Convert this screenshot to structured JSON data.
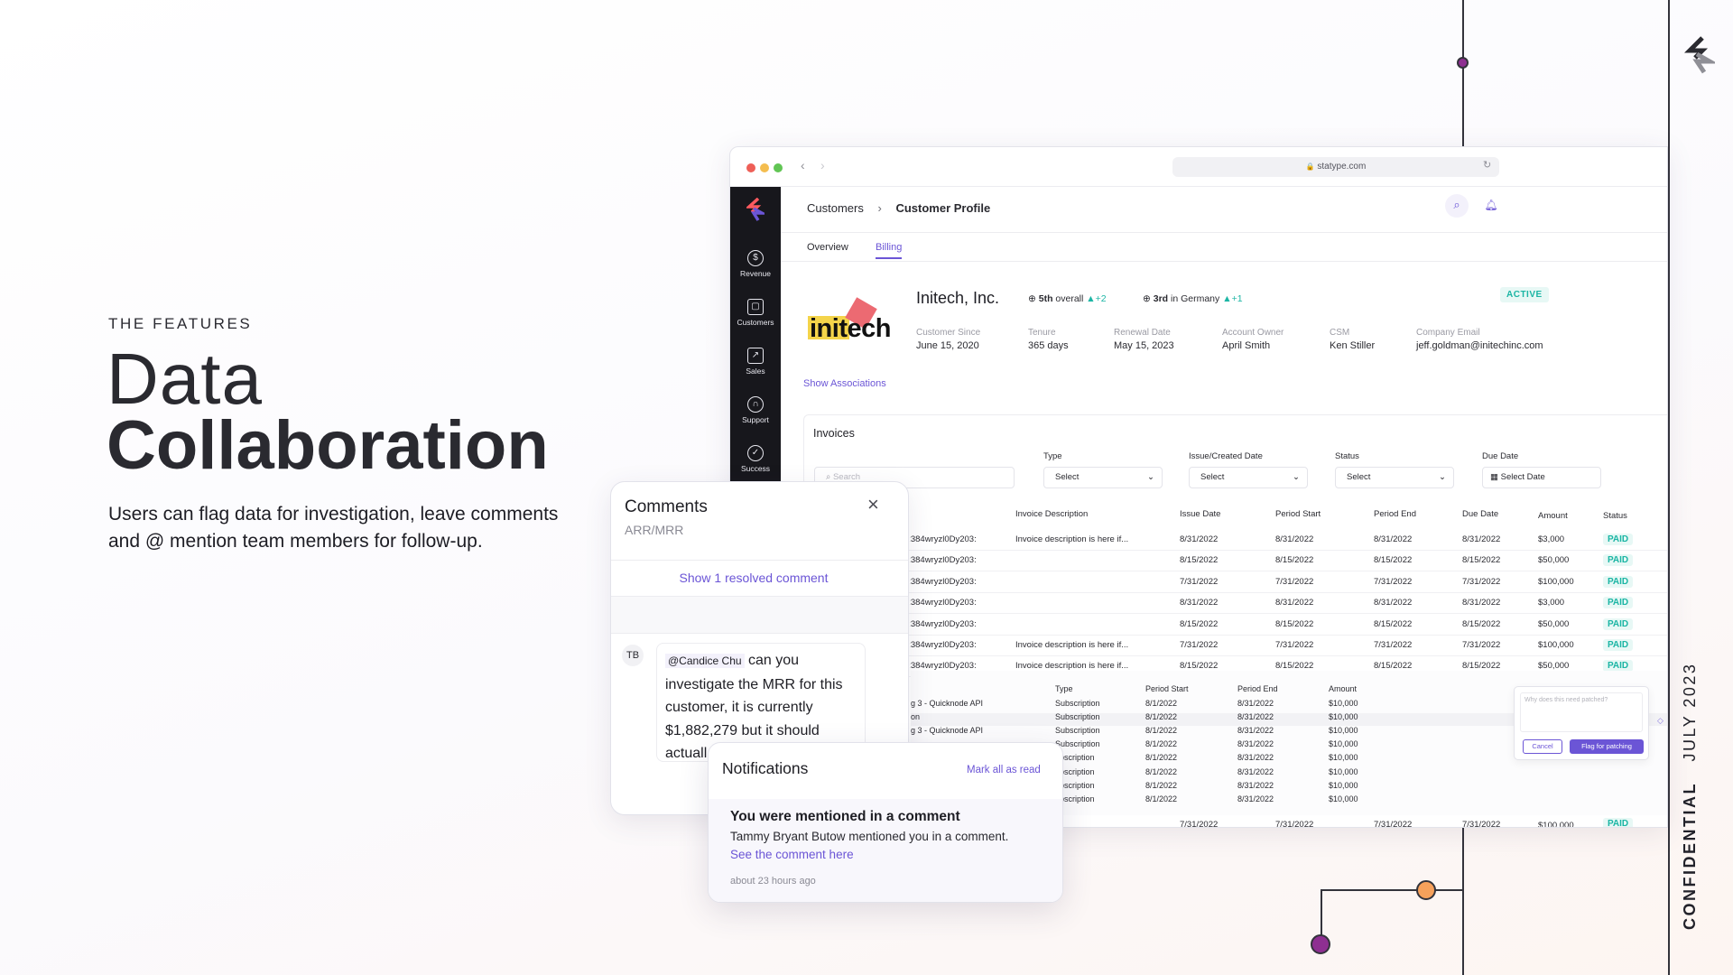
{
  "slide": {
    "eyebrow": "THE FEATURES",
    "title_light": "Data",
    "title_bold": "Collaboration",
    "body": "Users can flag data for investigation, leave comments and @ mention team members for follow-up.",
    "rail_confidential": "CONFIDENTIAL",
    "rail_date": "JULY 2023"
  },
  "browser": {
    "url": "statype.com",
    "breadcrumb": [
      "Customers",
      "Customer Profile"
    ],
    "tabs": [
      "Overview",
      "Billing"
    ],
    "active_tab": "Billing"
  },
  "sidebar": {
    "items": [
      {
        "label": "Revenue",
        "icon": "dollar-icon"
      },
      {
        "label": "Customers",
        "icon": "customers-icon"
      },
      {
        "label": "Sales",
        "icon": "chart-icon"
      },
      {
        "label": "Support",
        "icon": "headset-icon"
      },
      {
        "label": "Success",
        "icon": "check-icon"
      }
    ]
  },
  "customer": {
    "logo_text": "initech",
    "name": "Initech, Inc.",
    "rank_overall": "5th",
    "rank_overall_suffix": "overall",
    "rank_overall_delta": "+2",
    "rank_country": "3rd",
    "rank_country_suffix": "in Germany",
    "rank_country_delta": "+1",
    "status": "ACTIVE",
    "fields": [
      {
        "label": "Customer Since",
        "value": "June 15, 2020"
      },
      {
        "label": "Tenure",
        "value": "365 days"
      },
      {
        "label": "Renewal Date",
        "value": "May 15, 2023"
      },
      {
        "label": "Account Owner",
        "value": "April Smith"
      },
      {
        "label": "CSM",
        "value": "Ken Stiller"
      },
      {
        "label": "Company Email",
        "value": "jeff.goldman@initechinc.com"
      }
    ],
    "show_associations": "Show Associations"
  },
  "invoices": {
    "title": "Invoices",
    "search_placeholder": "Search",
    "filters": [
      {
        "label": "Type",
        "value": "Select"
      },
      {
        "label": "Issue/Created Date",
        "value": "Select"
      },
      {
        "label": "Status",
        "value": "Select"
      },
      {
        "label": "Due Date",
        "value": "Select Date"
      }
    ],
    "columns": [
      "Invoice Description",
      "Issue Date",
      "Period Start",
      "Period End",
      "Due Date",
      "Amount",
      "Status"
    ],
    "rows": [
      {
        "id": ":R384wryzl0Dy203",
        "desc": "Invoice description is here if...",
        "issue": "8/31/2022",
        "start": "8/31/2022",
        "end": "8/31/2022",
        "due": "8/31/2022",
        "amount": "$3,000",
        "status": "PAID"
      },
      {
        "id": ":R384wryzl0Dy203",
        "desc": "",
        "issue": "8/15/2022",
        "start": "8/15/2022",
        "end": "8/15/2022",
        "due": "8/15/2022",
        "amount": "$50,000",
        "status": "PAID"
      },
      {
        "id": ":R384wryzl0Dy203",
        "desc": "",
        "issue": "7/31/2022",
        "start": "7/31/2022",
        "end": "7/31/2022",
        "due": "7/31/2022",
        "amount": "$100,000",
        "status": "PAID"
      },
      {
        "id": ":R384wryzl0Dy203",
        "desc": "",
        "issue": "8/31/2022",
        "start": "8/31/2022",
        "end": "8/31/2022",
        "due": "8/31/2022",
        "amount": "$3,000",
        "status": "PAID"
      },
      {
        "id": ":R384wryzl0Dy203",
        "desc": "",
        "issue": "8/15/2022",
        "start": "8/15/2022",
        "end": "8/15/2022",
        "due": "8/15/2022",
        "amount": "$50,000",
        "status": "PAID"
      },
      {
        "id": ":R384wryzl0Dy203",
        "desc": "Invoice description is here if...",
        "issue": "7/31/2022",
        "start": "7/31/2022",
        "end": "7/31/2022",
        "due": "7/31/2022",
        "amount": "$100,000",
        "status": "PAID"
      },
      {
        "id": ":R384wryzl0Dy203",
        "desc": "Invoice description is here if...",
        "issue": "8/15/2022",
        "start": "8/15/2022",
        "end": "8/15/2022",
        "due": "8/15/2022",
        "amount": "$50,000",
        "status": "PAID"
      }
    ],
    "sub_columns": [
      "Type",
      "Period Start",
      "Period End",
      "Amount"
    ],
    "sub_rows": [
      {
        "name": "g 3 - Quicknode API",
        "type": "Subscription",
        "start": "8/1/2022",
        "end": "8/31/2022",
        "amount": "$10,000"
      },
      {
        "name": "on",
        "type": "Subscription",
        "start": "8/1/2022",
        "end": "8/31/2022",
        "amount": "$10,000"
      },
      {
        "name": "g 3 - Quicknode API",
        "type": "Subscription",
        "start": "8/1/2022",
        "end": "8/31/2022",
        "amount": "$10,000"
      },
      {
        "name": "",
        "type": "Subscription",
        "start": "8/1/2022",
        "end": "8/31/2022",
        "amount": "$10,000"
      },
      {
        "name": "",
        "type": "ubscription",
        "start": "8/1/2022",
        "end": "8/31/2022",
        "amount": "$10,000"
      },
      {
        "name": "",
        "type": "ubscription",
        "start": "8/1/2022",
        "end": "8/31/2022",
        "amount": "$10,000"
      },
      {
        "name": "",
        "type": "ubscription",
        "start": "8/1/2022",
        "end": "8/31/2022",
        "amount": "$10,000"
      },
      {
        "name": "",
        "type": "ubscription",
        "start": "8/1/2022",
        "end": "8/31/2022",
        "amount": "$10,000"
      }
    ],
    "last_row": {
      "issue": "7/31/2022",
      "start": "7/31/2022",
      "end": "7/31/2022",
      "due": "7/31/2022",
      "amount": "$100,000",
      "status": "PAID"
    },
    "flag": {
      "placeholder": "Why does this need patched?",
      "cancel": "Cancel",
      "submit": "Flag for patching"
    }
  },
  "comments": {
    "title": "Comments",
    "subtitle": "ARR/MRR",
    "show_resolved": "Show 1 resolved comment",
    "avatar": "TB",
    "mention": "@Candice Chu",
    "text": "can you investigate the MRR for this customer, it is currently $1,882,279 but it should actuall"
  },
  "notifications": {
    "title": "Notifications",
    "mark_all": "Mark all as read",
    "item_title": "You were mentioned in a comment",
    "item_body": "Tammy Bryant Butow mentioned you in a comment.",
    "item_link": "See the comment here",
    "item_time": "about 23 hours ago"
  },
  "colors": {
    "accent": "#6b55d6",
    "paid": "#1bb5a4",
    "dot_purple": "#8e2f91",
    "dot_orange": "#f6a15b"
  }
}
